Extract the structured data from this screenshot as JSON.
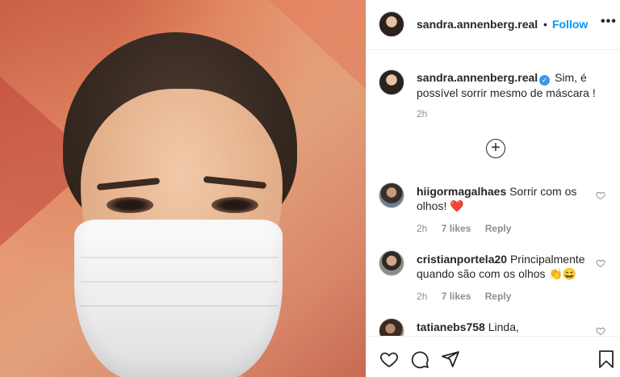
{
  "post": {
    "username": "sandra.annenberg.real",
    "separator": "•",
    "follow_label": "Follow",
    "more_label": "•••"
  },
  "caption": {
    "username": "sandra.annenberg.real",
    "text": "Sim, é possível sorrir mesmo de máscara !",
    "time": "2h",
    "verified_icon": "verified-badge-icon"
  },
  "load_more_label": "+",
  "comments": [
    {
      "username": "hiigormagalhaes",
      "text": "Sorrir com os olhos!",
      "emoji": "❤️",
      "time": "2h",
      "likes": "7 likes",
      "reply": "Reply"
    },
    {
      "username": "cristianportela20",
      "text": "Principalmente quando são com os olhos",
      "emoji": "👏😄",
      "time": "2h",
      "likes": "7 likes",
      "reply": "Reply"
    },
    {
      "username": "tatianebs758",
      "text": "Linda,",
      "emoji": "",
      "time": "",
      "likes": "",
      "reply": ""
    }
  ],
  "actions": {
    "like": "heart-icon",
    "comment": "comment-icon",
    "share": "share-icon",
    "save": "bookmark-icon"
  },
  "colors": {
    "accent": "#0095f6",
    "text": "#262626",
    "muted": "#8e8e8e",
    "verified": "#3897f0"
  }
}
